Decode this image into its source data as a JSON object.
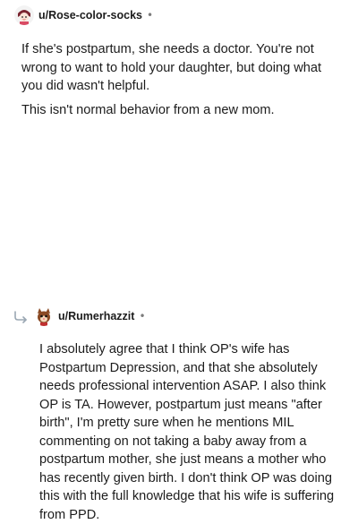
{
  "comments": [
    {
      "username": "u/Rose-color-socks",
      "separator": "•",
      "avatar_icon": "cartoon-girl-avatar-icon",
      "paragraphs": [
        "If she's postpartum, she needs a doctor. You're not wrong to want to hold your daughter, but doing what you did wasn't helpful.",
        "This isn't normal behavior from a new mom."
      ]
    },
    {
      "username": "u/Rumerhazzit",
      "separator": "•",
      "avatar_icon": "cartoon-cat-avatar-icon",
      "reply_icon": "reply-arrow-icon",
      "paragraphs": [
        "I absolutely agree that I think OP's wife has Postpartum Depression, and that she absolutely needs professional intervention ASAP. I also think OP is TA. However, postpartum just means \"after birth\", I'm pretty sure when he mentions MIL commenting on not taking a baby away from a postpartum mother, she just means a mother who has recently given birth. I don't think OP was doing this with the full knowledge that his wife is suffering from PPD."
      ]
    }
  ]
}
